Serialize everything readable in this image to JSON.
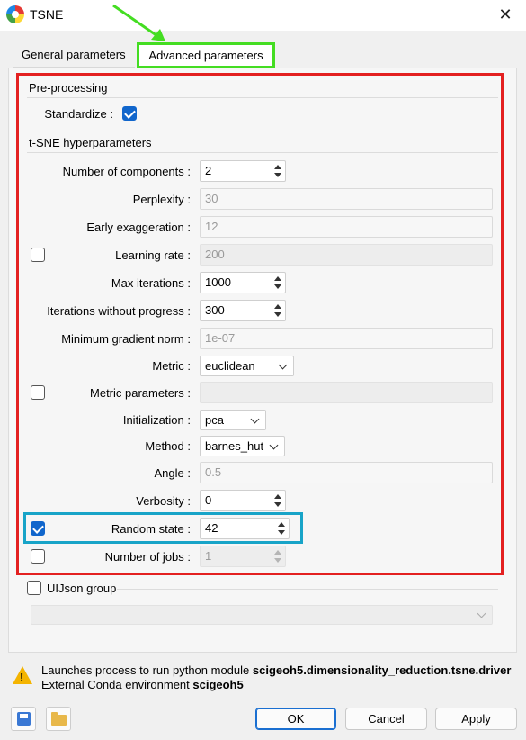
{
  "window": {
    "title": "TSNE",
    "close_glyph": "✕"
  },
  "tabs": {
    "general": "General parameters",
    "advanced": "Advanced parameters"
  },
  "preprocessing": {
    "title": "Pre-processing",
    "standardize_label": "Standardize :",
    "standardize_checked": true
  },
  "tsne": {
    "title": "t-SNE hyperparameters",
    "n_components": {
      "label": "Number of components :",
      "value": "2"
    },
    "perplexity": {
      "label": "Perplexity :",
      "value": "30"
    },
    "early_exaggeration": {
      "label": "Early exaggeration :",
      "value": "12"
    },
    "learning_rate": {
      "label": "Learning rate :",
      "value": "200",
      "checked": false
    },
    "max_iterations": {
      "label": "Max iterations :",
      "value": "1000"
    },
    "iter_without_progress": {
      "label": "Iterations without progress :",
      "value": "300"
    },
    "min_grad_norm": {
      "label": "Minimum gradient norm :",
      "value": "1e-07"
    },
    "metric": {
      "label": "Metric :",
      "value": "euclidean"
    },
    "metric_params": {
      "label": "Metric parameters :",
      "value": "",
      "checked": false
    },
    "init": {
      "label": "Initialization :",
      "value": "pca"
    },
    "method": {
      "label": "Method :",
      "value": "barnes_hut"
    },
    "angle": {
      "label": "Angle :",
      "value": "0.5"
    },
    "verbosity": {
      "label": "Verbosity :",
      "value": "0"
    },
    "random_state": {
      "label": "Random state :",
      "value": "42",
      "checked": true
    },
    "n_jobs": {
      "label": "Number of jobs :",
      "value": "1",
      "checked": false
    }
  },
  "uijson": {
    "label": "UIJson group",
    "checked": false,
    "value": ""
  },
  "info": {
    "line1_prefix": "Launches process to run python module ",
    "line1_module": "scigeoh5.dimensionality_reduction.tsne.driver",
    "line2_prefix": "External Conda environment ",
    "line2_env": "scigeoh5"
  },
  "buttons": {
    "ok": "OK",
    "cancel": "Cancel",
    "apply": "Apply"
  },
  "icons": {
    "app": "app-logo-icon",
    "close": "close-icon",
    "warning": "warning-icon",
    "save": "save-icon",
    "folder": "folder-icon",
    "spin": "spinbox-arrows-icon",
    "dropdown": "chevron-down-icon",
    "annotation_arrow": "arrow-icon"
  },
  "colors": {
    "annotation_red": "#e32020",
    "annotation_green": "#44dd22",
    "annotation_cyan": "#18a4c8",
    "accent": "#1166cc",
    "warning": "#f4b400"
  }
}
